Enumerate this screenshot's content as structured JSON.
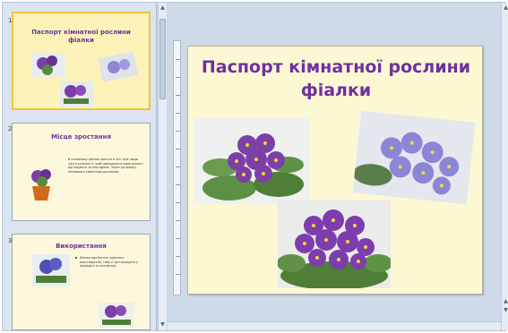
{
  "thumbnails": [
    {
      "number": "1",
      "title": "Паспорт кімнатної рослини фіалки"
    },
    {
      "number": "2",
      "title": "Місце зростання",
      "body": "В основному фіалка зростає в лісі. Але люди часто купують її, щоб прикрашати свою оселю і доглядають за нею вдома. Через це фіалку називають кімнатною рослиною."
    },
    {
      "number": "3",
      "title": "Використання",
      "body": "Фіалка має багато корисних властивостей, тому її застосовують у медицині та косметиці."
    }
  ],
  "slide": {
    "title": "Паспорт кімнатної рослини фіалки"
  },
  "colors": {
    "title_purple": "#7030a0",
    "slide_bg": "#fdf8d4",
    "selected_border": "#f3c33d",
    "violet_flower": "#7b3fa6",
    "blue_flower": "#8b86d6"
  },
  "icons": {
    "scroll_up": "▲",
    "scroll_down": "▼"
  }
}
